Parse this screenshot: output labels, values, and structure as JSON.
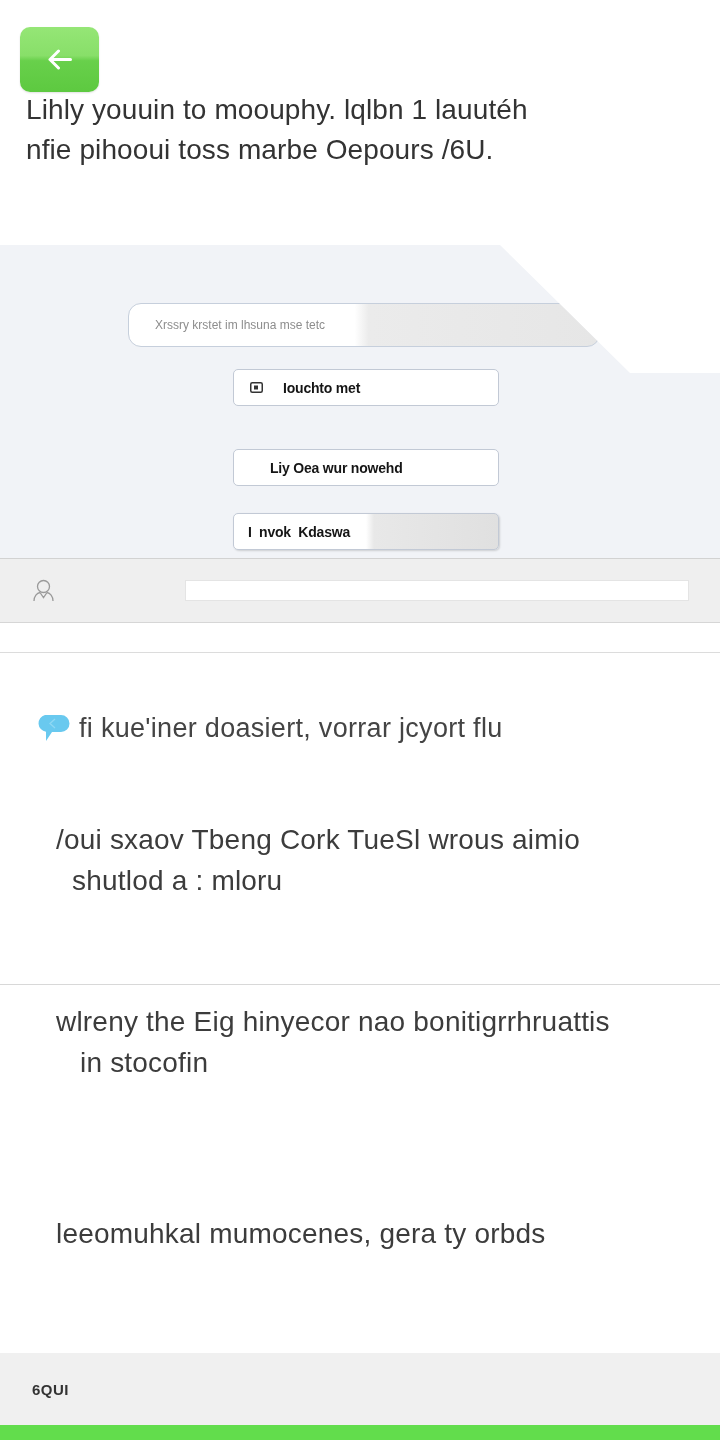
{
  "heading": {
    "lines": [
      "Lihly youuin to moouphy. lqlbn 1 lauutéh",
      "nfie pihooui toss marbe Oepours /6U."
    ]
  },
  "form": {
    "search": {
      "placeholder": "Xrssry krstet im lhsuna mse tetc"
    },
    "buttons": [
      {
        "kind": "icon",
        "label": "Iouchto met"
      },
      {
        "kind": "plain",
        "label": "Liy Oea wur nowehd"
      },
      {
        "kind": "shaded",
        "label": "I  nvok  Kdaswa"
      }
    ]
  },
  "message": {
    "text": "fi kue'iner doasiert, vorrar jcyort flu"
  },
  "paragraphs": [
    {
      "lines": [
        "/oui sxaov Tbeng Cork TueSl wrous aimio",
        "shutlod a : mloru"
      ]
    },
    {
      "lines": [
        "wlreny the Eig hinyecor nao bonitigrrhruattis",
        "in stocofin"
      ]
    },
    {
      "lines": [
        "leeomuhkal mumocenes,  gera ty orbds"
      ]
    }
  ],
  "footer": {
    "label": "6QUI"
  }
}
